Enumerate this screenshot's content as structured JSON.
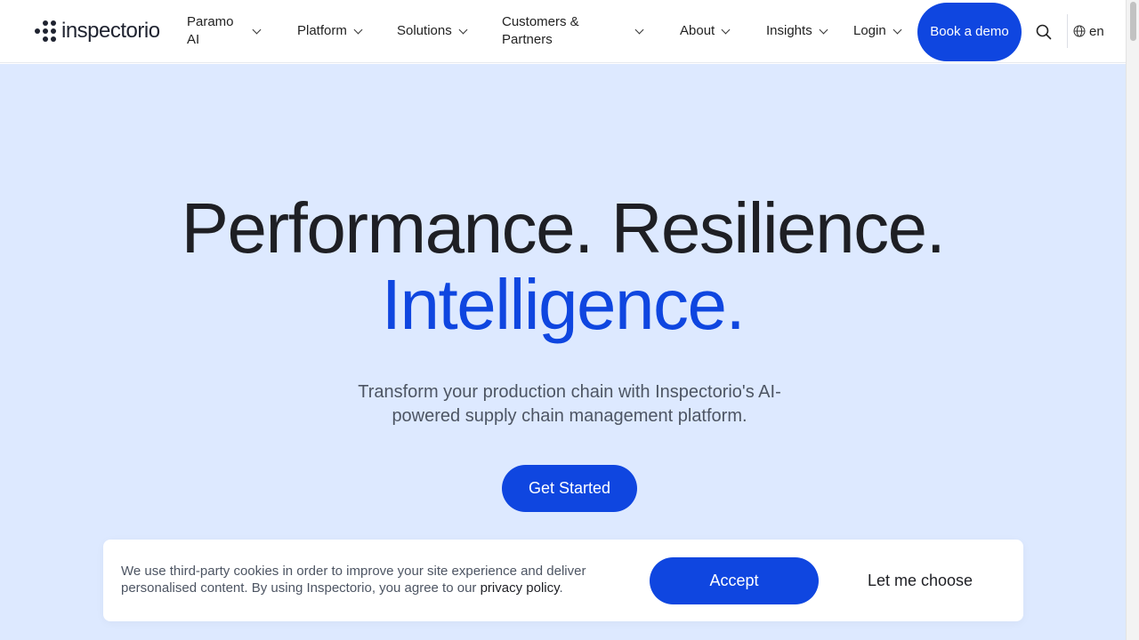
{
  "brand": {
    "name": "inspectorio",
    "logo_icon": "dot-grid-logo-icon",
    "accent_color": "#0f46e0"
  },
  "nav": {
    "items": [
      {
        "label": "Paramo AI",
        "icon": "chevron-down-icon"
      },
      {
        "label": "Platform",
        "icon": "chevron-down-icon"
      },
      {
        "label": "Solutions",
        "icon": "chevron-down-icon"
      },
      {
        "label": "Customers & Partners",
        "icon": "chevron-down-icon"
      },
      {
        "label": "About",
        "icon": "chevron-down-icon"
      },
      {
        "label": "Insights",
        "icon": "chevron-down-icon"
      },
      {
        "label": "Login",
        "icon": "chevron-down-icon"
      }
    ],
    "book_demo_label": "Book a demo",
    "search_icon": "search-icon",
    "language": {
      "icon": "globe-icon",
      "code": "en"
    }
  },
  "hero": {
    "headline_line1": "Performance. Resilience.",
    "headline_line2": "Intelligence.",
    "subtitle": "Transform your production chain with Inspectorio's AI-powered supply chain management platform.",
    "cta_label": "Get Started",
    "background_color": "#dde9ff"
  },
  "cookie_banner": {
    "text": "We use third-party cookies in order to improve your site experience and deliver personalised content. By using Inspectorio, you agree to our",
    "link_text": "privacy policy",
    "trailing": ".",
    "accept_label": "Accept",
    "choose_label": "Let me choose"
  }
}
